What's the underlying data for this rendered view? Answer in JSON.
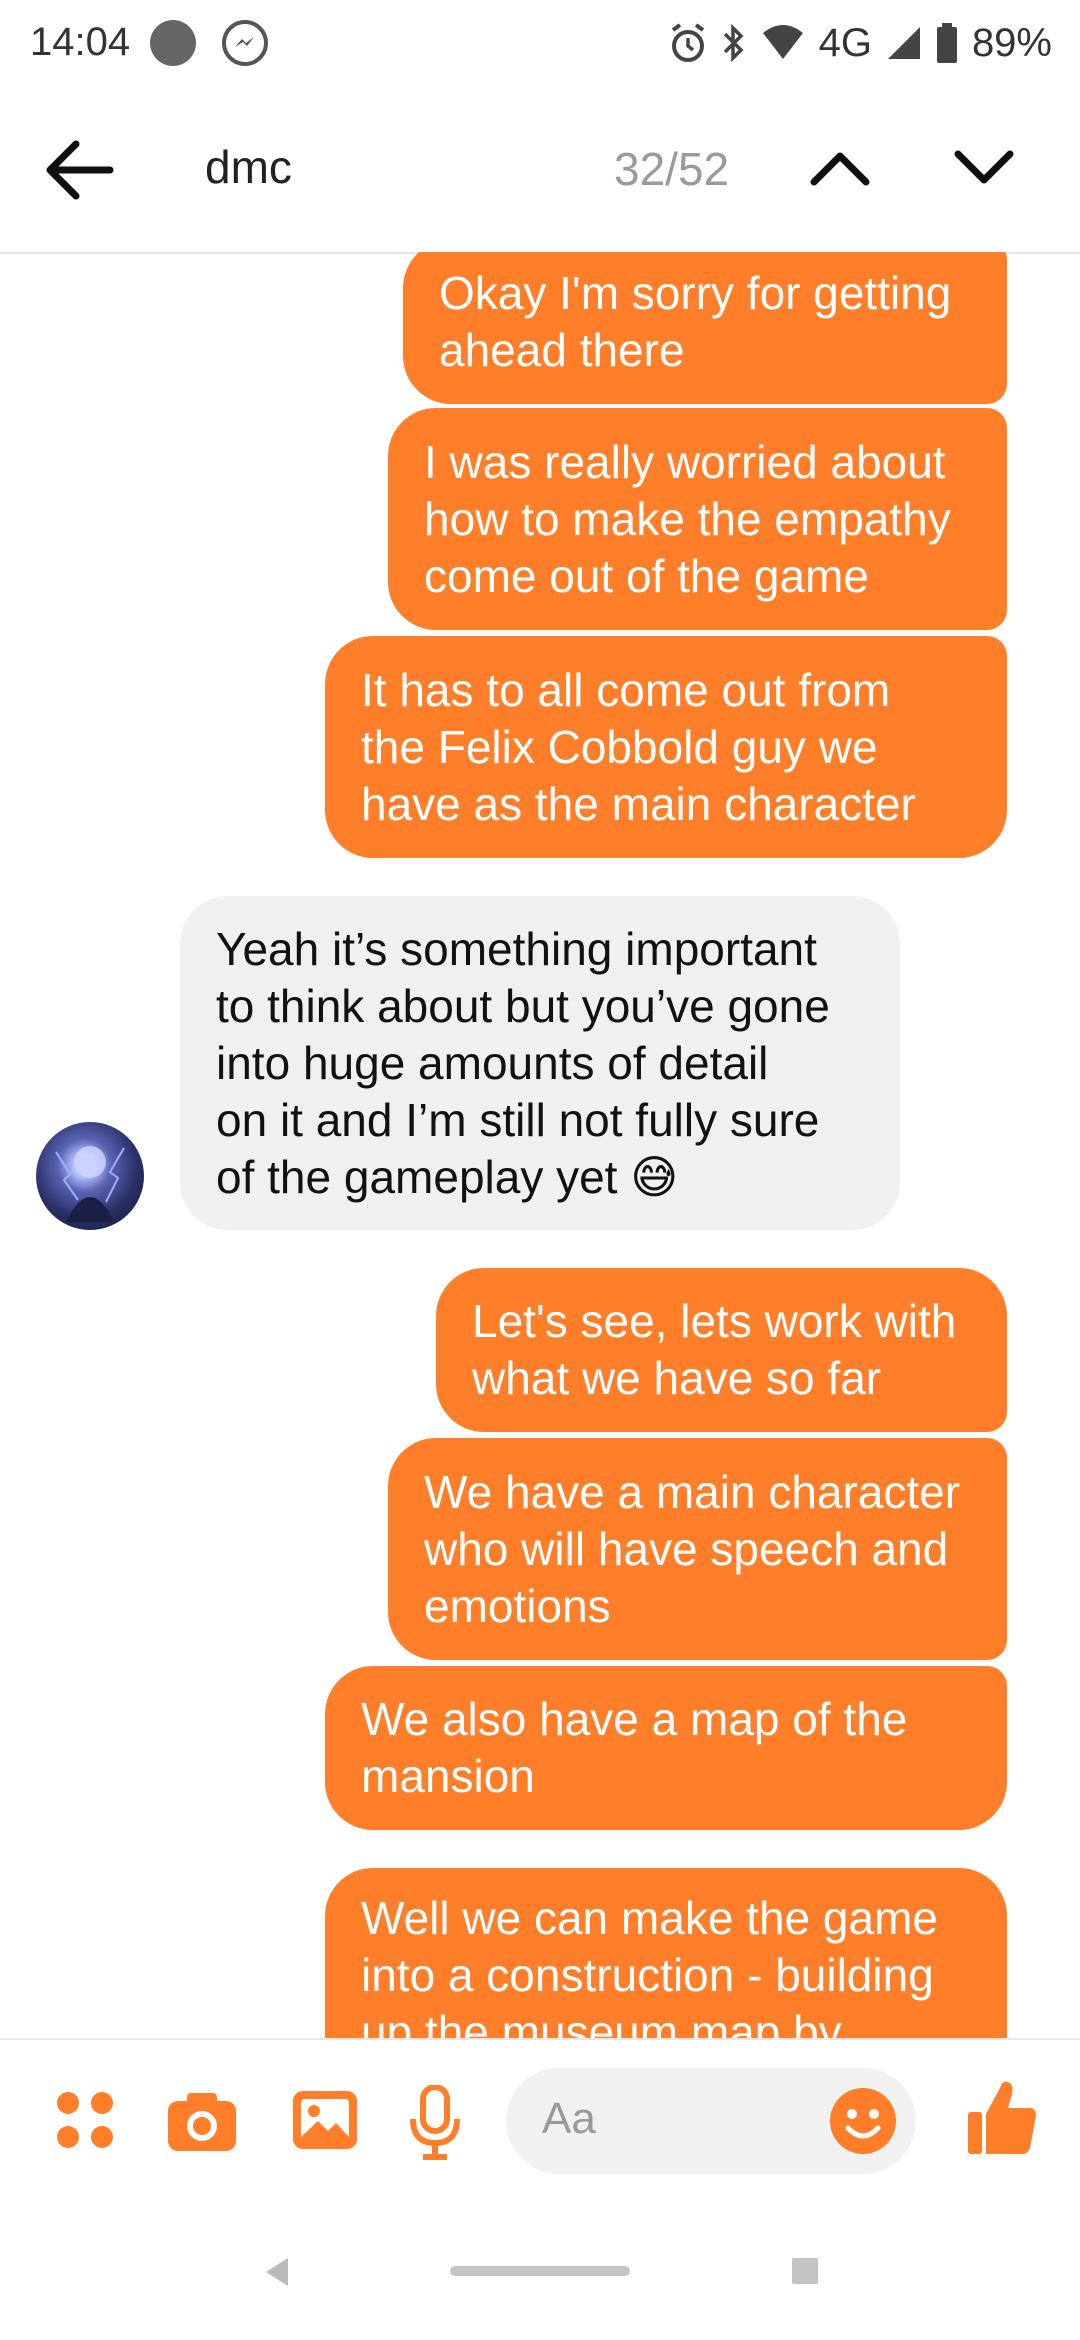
{
  "status_bar": {
    "time": "14:04",
    "network": "4G",
    "battery": "89%",
    "icons": [
      "notification-dot-icon",
      "messenger-icon",
      "alarm-icon",
      "bluetooth-icon",
      "wifi-icon",
      "signal-icon",
      "battery-icon"
    ]
  },
  "header": {
    "back_icon": "arrow-left-icon",
    "search_query": "dmc",
    "match_counter": "32/52",
    "prev_icon": "chevron-up-icon",
    "next_icon": "chevron-down-icon"
  },
  "messages": [
    {
      "side": "out",
      "lines": [
        "Okay I'm sorry for getting",
        "ahead there"
      ]
    },
    {
      "side": "out",
      "lines": [
        "I was really worried about",
        "how to make the empathy",
        "come out of the game"
      ]
    },
    {
      "side": "out",
      "lines": [
        "It has to all come out from",
        "the Felix Cobbold guy we",
        "have as the main character"
      ]
    },
    {
      "side": "in",
      "lines": [
        "Yeah it’s something important",
        "to think about but you’ve gone",
        "into huge amounts of detail",
        "on it and I’m still not fully sure",
        "of the gameplay yet 😅"
      ]
    },
    {
      "side": "out",
      "lines": [
        "Let's see, lets work with",
        "what we have so far"
      ]
    },
    {
      "side": "out",
      "lines": [
        "We have a main character",
        "who will have speech and",
        "emotions"
      ]
    },
    {
      "side": "out",
      "lines": [
        "We also have a map of the",
        "mansion"
      ]
    },
    {
      "side": "out",
      "lines": [
        "Well we can make the game",
        "into a construction - building",
        "up the museum map by"
      ]
    }
  ],
  "composer": {
    "placeholder": "Aa",
    "icons": [
      "menu-dots-icon",
      "camera-icon",
      "gallery-icon",
      "microphone-icon",
      "emoji-icon",
      "thumbs-up-icon"
    ]
  },
  "colors": {
    "accent": "#ff7e29",
    "incoming_bubble": "#f0f0f0"
  }
}
